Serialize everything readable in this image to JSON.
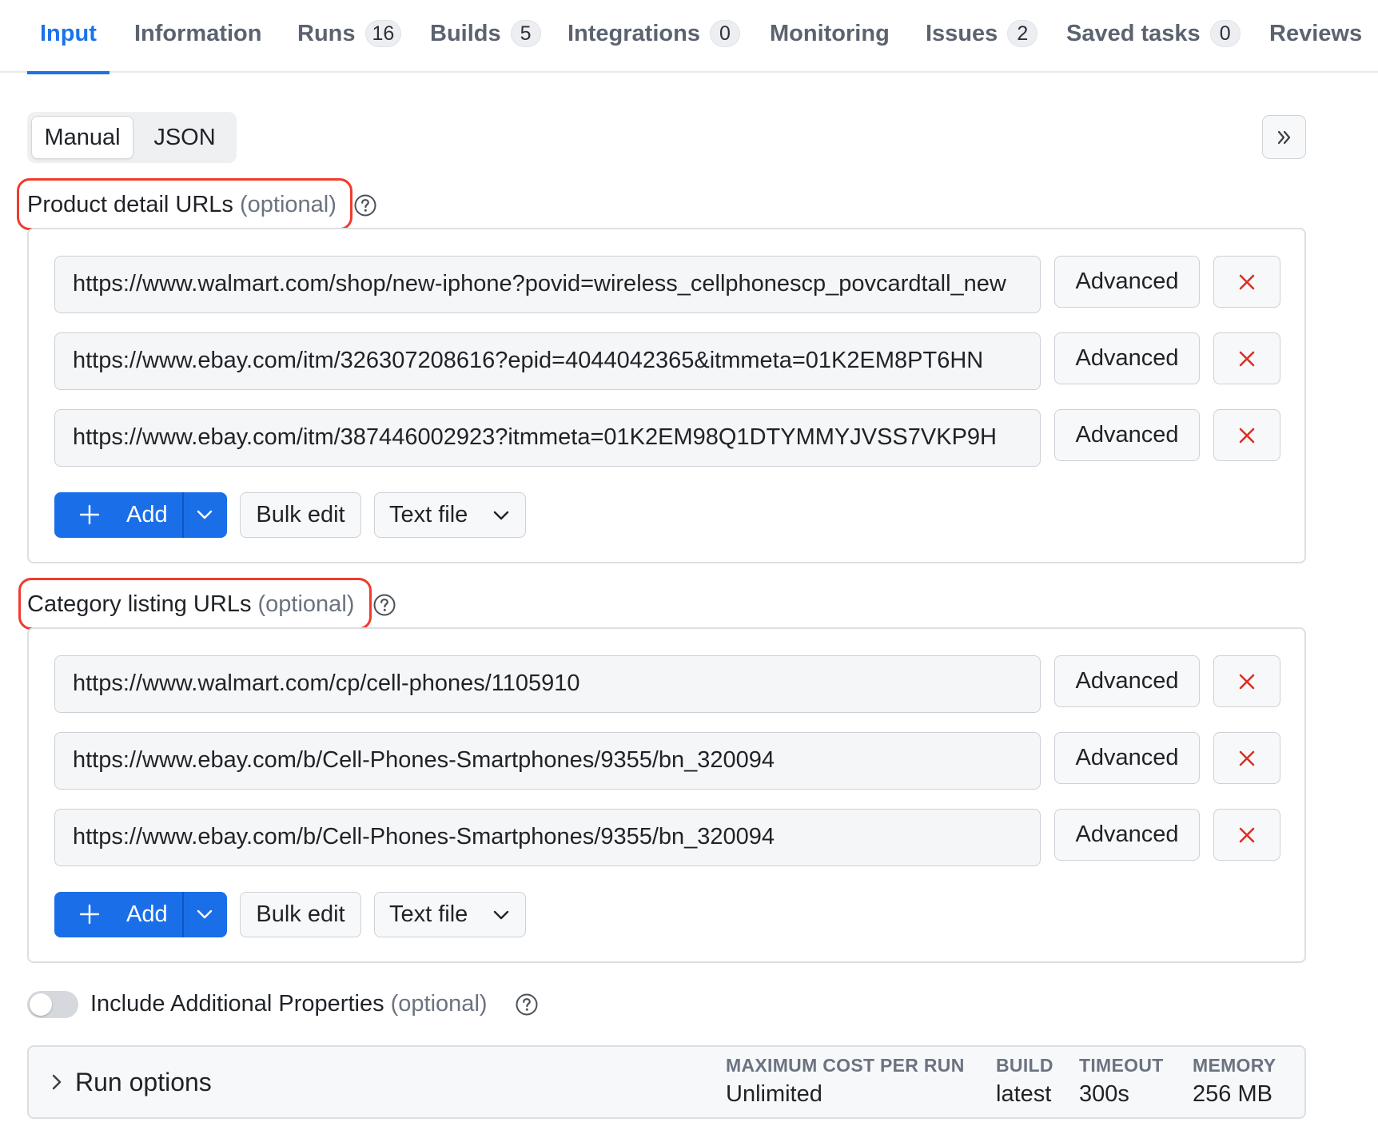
{
  "tabs": [
    {
      "label": "Input",
      "count": null,
      "active": true
    },
    {
      "label": "Information",
      "count": null
    },
    {
      "label": "Runs",
      "count": "16"
    },
    {
      "label": "Builds",
      "count": "5"
    },
    {
      "label": "Integrations",
      "count": "0"
    },
    {
      "label": "Monitoring",
      "count": null
    },
    {
      "label": "Issues",
      "count": "2"
    },
    {
      "label": "Saved tasks",
      "count": "0"
    },
    {
      "label": "Reviews",
      "count": null
    }
  ],
  "mode_toggle": {
    "manual": "Manual",
    "json": "JSON",
    "selected": "Manual"
  },
  "product_section": {
    "label": "Product detail URLs",
    "optional": "(optional)",
    "urls": [
      "https://www.walmart.com/shop/new-iphone?povid=wireless_cellphonescp_povcardtall_new",
      "https://www.ebay.com/itm/326307208616?epid=4044042365&itmmeta=01K2EM8PT6HN",
      "https://www.ebay.com/itm/387446002923?itmmeta=01K2EM98Q1DTYMMYJVSS7VKP9H"
    ]
  },
  "category_section": {
    "label": "Category listing URLs",
    "optional": "(optional)",
    "urls": [
      "https://www.walmart.com/cp/cell-phones/1105910",
      "https://www.ebay.com/b/Cell-Phones-Smartphones/9355/bn_320094",
      "https://www.ebay.com/b/Cell-Phones-Smartphones/9355/bn_320094"
    ]
  },
  "row_buttons": {
    "advanced": "Advanced"
  },
  "list_buttons": {
    "add": "Add",
    "bulk_edit": "Bulk edit",
    "text_file": "Text file"
  },
  "additional_properties": {
    "label": "Include Additional Properties",
    "optional": "(optional)",
    "enabled": false
  },
  "run_options": {
    "title": "Run options",
    "max_cost_label": "MAXIMUM COST PER RUN",
    "max_cost_value": "Unlimited",
    "build_label": "BUILD",
    "build_value": "latest",
    "timeout_label": "TIMEOUT",
    "timeout_value": "300s",
    "memory_label": "MEMORY",
    "memory_value": "256 MB"
  },
  "colors": {
    "accent": "#1a73e8",
    "highlight": "#ef3b2d",
    "delete": "#d93025"
  },
  "icons": [
    "help-icon",
    "double-chevron-right-icon",
    "close-icon",
    "plus-icon",
    "chevron-down-icon",
    "chevron-right-icon"
  ]
}
